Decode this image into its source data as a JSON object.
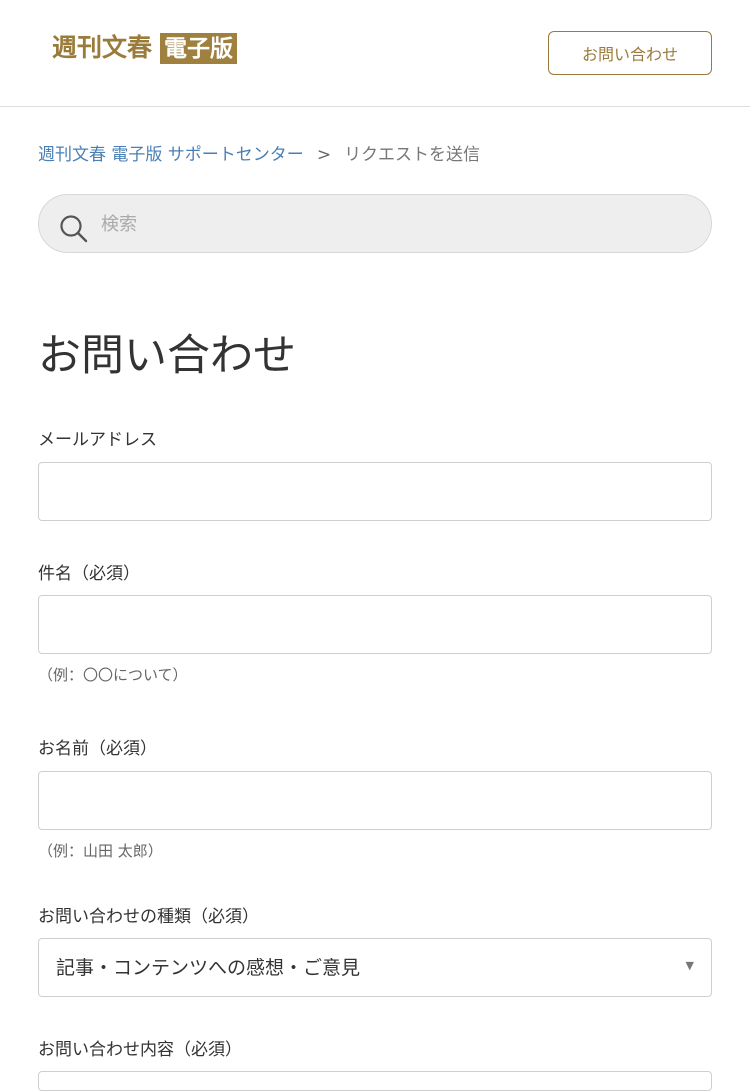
{
  "header": {
    "logo_text": "週刊文春",
    "logo_badge": "電子版",
    "contact_button": "お問い合わせ"
  },
  "breadcrumb": {
    "home": "週刊文春 電子版 サポートセンター",
    "separator": ">",
    "current": "リクエストを送信"
  },
  "search": {
    "placeholder": "検索"
  },
  "page": {
    "title": "お問い合わせ"
  },
  "form": {
    "email": {
      "label": "メールアドレス",
      "value": ""
    },
    "subject": {
      "label": "件名（必須）",
      "value": "",
      "hint": "（例：〇〇について）"
    },
    "name": {
      "label": "お名前（必須）",
      "value": "",
      "hint": "（例：山田 太郎）"
    },
    "inquiry_type": {
      "label": "お問い合わせの種類（必須）",
      "selected": "記事・コンテンツへの感想・ご意見"
    },
    "content": {
      "label": "お問い合わせ内容（必須）"
    }
  },
  "colors": {
    "brand_gold": "#9a7b3a",
    "link_blue": "#4a7fb5"
  },
  "icons": {
    "search": "search-icon",
    "dropdown": "chevron-down-icon"
  }
}
